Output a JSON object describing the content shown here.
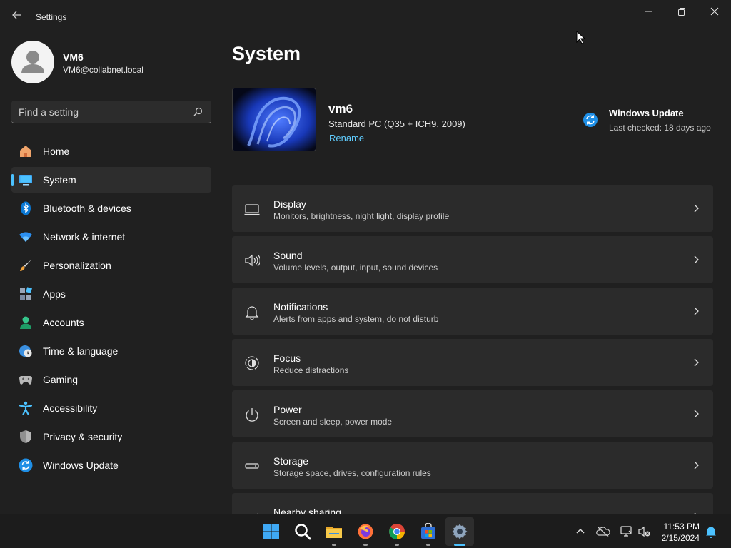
{
  "window": {
    "title": "Settings"
  },
  "user": {
    "name": "VM6",
    "email": "VM6@collabnet.local"
  },
  "search": {
    "placeholder": "Find a setting"
  },
  "sidebar": {
    "items": [
      {
        "label": "Home",
        "icon": "home-icon"
      },
      {
        "label": "System",
        "icon": "system-icon",
        "active": true
      },
      {
        "label": "Bluetooth & devices",
        "icon": "bluetooth-icon"
      },
      {
        "label": "Network & internet",
        "icon": "wifi-icon"
      },
      {
        "label": "Personalization",
        "icon": "brush-icon"
      },
      {
        "label": "Apps",
        "icon": "apps-icon"
      },
      {
        "label": "Accounts",
        "icon": "accounts-icon"
      },
      {
        "label": "Time & language",
        "icon": "clock-globe-icon"
      },
      {
        "label": "Gaming",
        "icon": "gamepad-icon"
      },
      {
        "label": "Accessibility",
        "icon": "accessibility-icon"
      },
      {
        "label": "Privacy & security",
        "icon": "shield-icon"
      },
      {
        "label": "Windows Update",
        "icon": "update-icon"
      }
    ]
  },
  "main": {
    "title": "System",
    "device": {
      "name": "vm6",
      "model": "Standard PC (Q35 + ICH9, 2009)",
      "rename_label": "Rename"
    },
    "update": {
      "title": "Windows Update",
      "status": "Last checked: 18 days ago"
    },
    "cards": [
      {
        "title": "Display",
        "subtitle": "Monitors, brightness, night light, display profile",
        "icon": "monitor-icon"
      },
      {
        "title": "Sound",
        "subtitle": "Volume levels, output, input, sound devices",
        "icon": "speaker-icon"
      },
      {
        "title": "Notifications",
        "subtitle": "Alerts from apps and system, do not disturb",
        "icon": "bell-icon"
      },
      {
        "title": "Focus",
        "subtitle": "Reduce distractions",
        "icon": "focus-icon"
      },
      {
        "title": "Power",
        "subtitle": "Screen and sleep, power mode",
        "icon": "power-icon"
      },
      {
        "title": "Storage",
        "subtitle": "Storage space, drives, configuration rules",
        "icon": "storage-icon"
      },
      {
        "title": "Nearby sharing",
        "subtitle": "",
        "icon": "share-icon"
      }
    ]
  },
  "taskbar": {
    "apps": [
      "start-icon",
      "search-icon",
      "file-explorer-icon",
      "firefox-icon",
      "chrome-icon",
      "store-icon",
      "settings-gear-icon"
    ],
    "time": "11:53 PM",
    "date": "2/15/2024"
  },
  "colors": {
    "accent": "#4cc2ff",
    "link": "#60cdff",
    "background": "#202020",
    "card": "#2b2b2b"
  }
}
